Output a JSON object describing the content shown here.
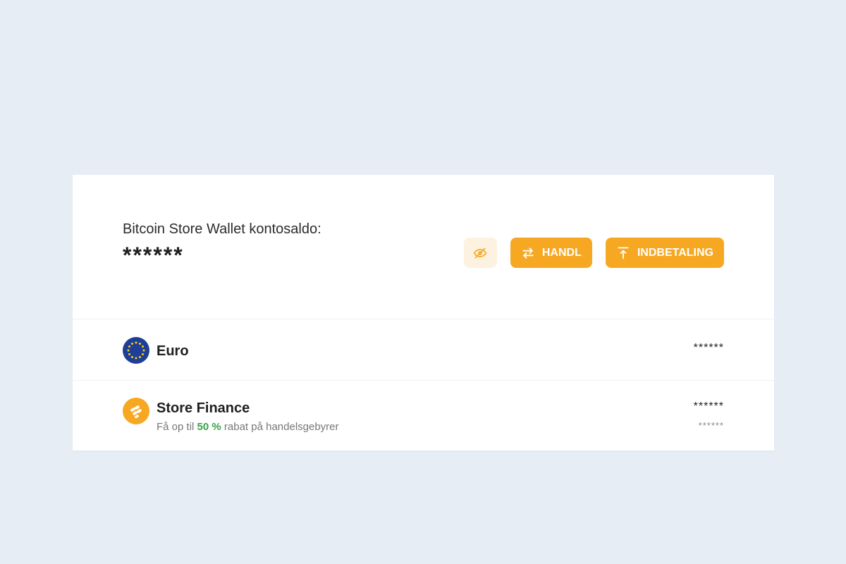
{
  "wallet": {
    "balance_label": "Bitcoin Store Wallet kontosaldo:",
    "balance_value": "******"
  },
  "actions": {
    "toggle_visibility_icon": "eye-off-icon",
    "trade_label": "HANDL",
    "trade_icon": "swap-arrows-icon",
    "deposit_label": "INDBETALING",
    "deposit_icon": "upload-arrow-icon"
  },
  "assets": [
    {
      "name": "Euro",
      "icon": "eu-flag-icon",
      "amount": "******"
    },
    {
      "name": "Store Finance",
      "icon": "store-finance-logo-icon",
      "sub_prefix": "Få op til",
      "sub_highlight": "50 %",
      "sub_suffix": "rabat på handelsgebyrer",
      "amount": "******",
      "amount_secondary": "******"
    }
  ],
  "colors": {
    "accent": "#f7a823",
    "accent_light": "#fdf2df",
    "highlight_green": "#3aa24b",
    "background": "#e6edf4",
    "eu_blue": "#1f3f97",
    "eu_star": "#f6d01a"
  }
}
